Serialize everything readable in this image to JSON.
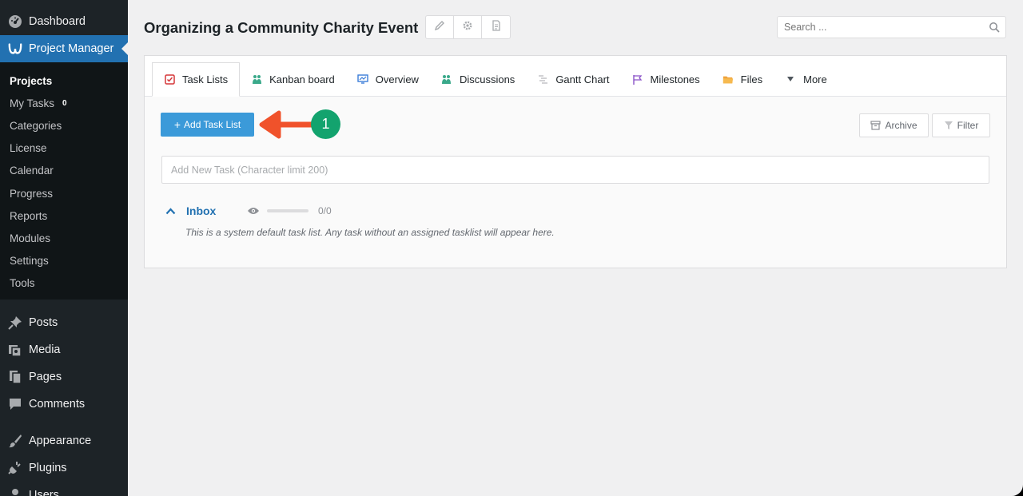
{
  "sidebar": {
    "dashboard": "Dashboard",
    "project_manager": "Project Manager",
    "submenu": [
      {
        "label": "Projects"
      },
      {
        "label": "My Tasks",
        "count": "0"
      },
      {
        "label": "Categories"
      },
      {
        "label": "License"
      },
      {
        "label": "Calendar"
      },
      {
        "label": "Progress"
      },
      {
        "label": "Reports"
      },
      {
        "label": "Modules"
      },
      {
        "label": "Settings"
      },
      {
        "label": "Tools"
      }
    ],
    "posts": "Posts",
    "media": "Media",
    "pages": "Pages",
    "comments": "Comments",
    "appearance": "Appearance",
    "plugins": "Plugins",
    "users": "Users"
  },
  "header": {
    "title": "Organizing a Community Charity Event",
    "search_placeholder": "Search ..."
  },
  "tabs": [
    {
      "label": "Task Lists",
      "icon": "task-lists-icon"
    },
    {
      "label": "Kanban board",
      "icon": "kanban-icon"
    },
    {
      "label": "Overview",
      "icon": "overview-icon"
    },
    {
      "label": "Discussions",
      "icon": "discussions-icon"
    },
    {
      "label": "Gantt Chart",
      "icon": "gantt-icon"
    },
    {
      "label": "Milestones",
      "icon": "milestone-flag-icon"
    },
    {
      "label": "Files",
      "icon": "folder-icon"
    },
    {
      "label": "More",
      "icon": "caret-down-icon"
    }
  ],
  "toolbar": {
    "add_task_list": "Add Task List",
    "add_plus": "+",
    "callout_number": "1",
    "archive": "Archive",
    "filter": "Filter"
  },
  "new_task": {
    "placeholder": "Add New Task (Character limit 200)"
  },
  "inbox": {
    "title": "Inbox",
    "count": "0/0",
    "progress_fraction": 0,
    "description": "This is a system default task list. Any task without an assigned tasklist will appear here."
  },
  "colors": {
    "accent": "#2271b1",
    "button": "#3b9ad9",
    "arrow": "#f0522b",
    "badge": "#13a36e"
  }
}
